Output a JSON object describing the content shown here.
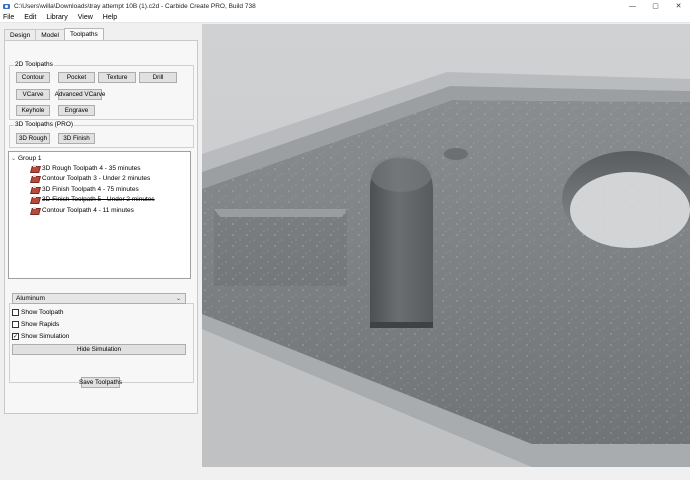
{
  "window": {
    "title": "C:\\Users\\willa\\Downloads\\tray attempt 10B (1).c2d - Carbide Create PRO, Build 738",
    "minimize": "—",
    "maximize": "▢",
    "close": "✕"
  },
  "menu": [
    "File",
    "Edit",
    "Library",
    "View",
    "Help"
  ],
  "tabs": [
    "Design",
    "Model",
    "Toolpaths"
  ],
  "active_tab": "Toolpaths",
  "toolpaths_2d": {
    "title": "2D Toolpaths",
    "buttons": [
      "Contour",
      "Pocket",
      "Texture",
      "Drill",
      "VCarve",
      "Advanced VCarve",
      "Keyhole",
      "Engrave"
    ]
  },
  "toolpaths_3d": {
    "title": "3D Toolpaths (PRO)",
    "buttons": [
      "3D Rough",
      "3D Finish"
    ]
  },
  "tree": {
    "group": "Group 1",
    "items": [
      {
        "label": "3D Rough Toolpath 4 - 35 minutes",
        "disabled": false
      },
      {
        "label": "Contour Toolpath 3 - Under 2 minutes",
        "disabled": false
      },
      {
        "label": "3D Finish Toolpath 4 - 75 minutes",
        "disabled": false
      },
      {
        "label": "3D Finish Toolpath 5 - Under 2 minutes",
        "disabled": true
      },
      {
        "label": "Contour Toolpath 4 - 11 minutes",
        "disabled": false
      }
    ]
  },
  "simulation": {
    "title": "Simulation",
    "material": "Aluminum",
    "show_toolpath": {
      "label": "Show Toolpath",
      "checked": false
    },
    "show_rapids": {
      "label": "Show Rapids",
      "checked": false
    },
    "show_simulation": {
      "label": "Show Simulation",
      "checked": true
    },
    "hide_button": "Hide Simulation"
  },
  "save_button": "Save Toolpaths",
  "colors": {
    "viewport_bg": "#c9cbcd",
    "part_surface": "#7f8285",
    "button_face": "#e1e1e1"
  }
}
